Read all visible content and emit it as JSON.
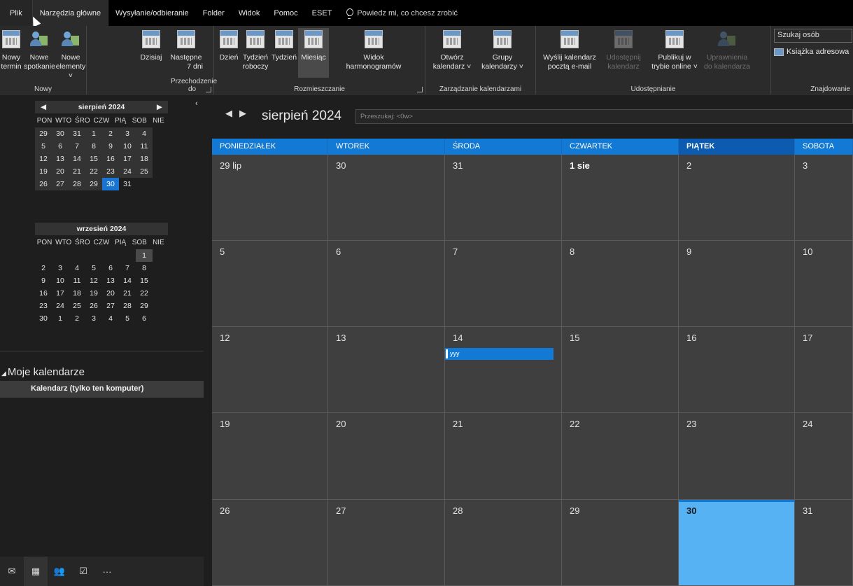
{
  "menu": {
    "items": [
      "Plik",
      "Narzędzia główne",
      "Wysyłanie/odbieranie",
      "Folder",
      "Widok",
      "Pomoc",
      "ESET"
    ],
    "tell_me": "Powiedz mi, co chcesz zrobić"
  },
  "ribbon": {
    "new_group": {
      "label": "Nowy",
      "new_appointment": [
        "Nowy",
        "termin"
      ],
      "new_meeting": [
        "Nowe",
        "spotkanie"
      ],
      "new_items": [
        "Nowe",
        "elementy ˅"
      ]
    },
    "goto_group": {
      "label": "Przechodzenie do",
      "today": "Dzisiaj",
      "next7": [
        "Następne",
        "7 dni"
      ]
    },
    "arrange_group": {
      "label": "Rozmieszczanie",
      "day": "Dzień",
      "work_week": [
        "Tydzień",
        "roboczy"
      ],
      "week": "Tydzień",
      "month": "Miesiąc",
      "schedule": [
        "Widok",
        "harmonogramów"
      ]
    },
    "manage_group": {
      "label": "Zarządzanie kalendarzami",
      "open": [
        "Otwórz",
        "kalendarz ˅"
      ],
      "groups": [
        "Grupy",
        "kalendarzy ˅"
      ]
    },
    "share_group": {
      "label": "Udostępnianie",
      "email": [
        "Wyślij kalendarz",
        "pocztą e-mail"
      ],
      "share": [
        "Udostępnij",
        "kalendarz"
      ],
      "publish": [
        "Publikuj w",
        "trybie online ˅"
      ],
      "permissions": [
        "Uprawnienia",
        "do kalendarza"
      ]
    },
    "find_group": {
      "label": "Znajdowanie",
      "search_people": "Szukaj osób",
      "address_book": "Książka adresowa"
    }
  },
  "nav": {
    "mini1": {
      "title": "sierpień 2024",
      "dow": [
        "PON",
        "WTO",
        "ŚRO",
        "CZW",
        "PIĄ",
        "SOB",
        "NIE"
      ],
      "days": [
        "29",
        "30",
        "31",
        "1",
        "2",
        "3",
        "4",
        "5",
        "6",
        "7",
        "8",
        "9",
        "10",
        "11",
        "12",
        "13",
        "14",
        "15",
        "16",
        "17",
        "18",
        "19",
        "20",
        "21",
        "22",
        "23",
        "24",
        "25",
        "26",
        "27",
        "28",
        "29",
        "30",
        "31"
      ]
    },
    "mini2": {
      "title": "wrzesień 2024",
      "dow": [
        "PON",
        "WTO",
        "ŚRO",
        "CZW",
        "PIĄ",
        "SOB",
        "NIE"
      ],
      "days": [
        "",
        "",
        "",
        "",
        "",
        "",
        "1",
        "2",
        "3",
        "4",
        "5",
        "6",
        "7",
        "8",
        "9",
        "10",
        "11",
        "12",
        "13",
        "14",
        "15",
        "16",
        "17",
        "18",
        "19",
        "20",
        "21",
        "22",
        "23",
        "24",
        "25",
        "26",
        "27",
        "28",
        "29",
        "30",
        "1",
        "2",
        "3",
        "4",
        "5",
        "6"
      ]
    },
    "my_calendars": "Moje kalendarze",
    "calendar_item": "Kalendarz (tylko ten komputer)"
  },
  "main": {
    "title": "sierpień 2024",
    "search_placeholder": "Przeszukaj: <0w>",
    "dow_headers": [
      "PONIEDZIAŁEK",
      "WTOREK",
      "ŚRODA",
      "CZWARTEK",
      "PIĄTEK",
      "SOBOTA"
    ],
    "weeks": [
      [
        "29 lip",
        "30",
        "31",
        "1 sie",
        "2",
        "3"
      ],
      [
        "5",
        "6",
        "7",
        "8",
        "9",
        "10"
      ],
      [
        "12",
        "13",
        "14",
        "15",
        "16",
        "17"
      ],
      [
        "19",
        "20",
        "21",
        "22",
        "23",
        "24"
      ],
      [
        "26",
        "27",
        "28",
        "29",
        "30",
        "31"
      ]
    ],
    "event": "yyy"
  },
  "colors": {
    "accent": "#1279d4",
    "today_cell": "#56b2f2",
    "cell_bg": "#3f3f3f"
  }
}
